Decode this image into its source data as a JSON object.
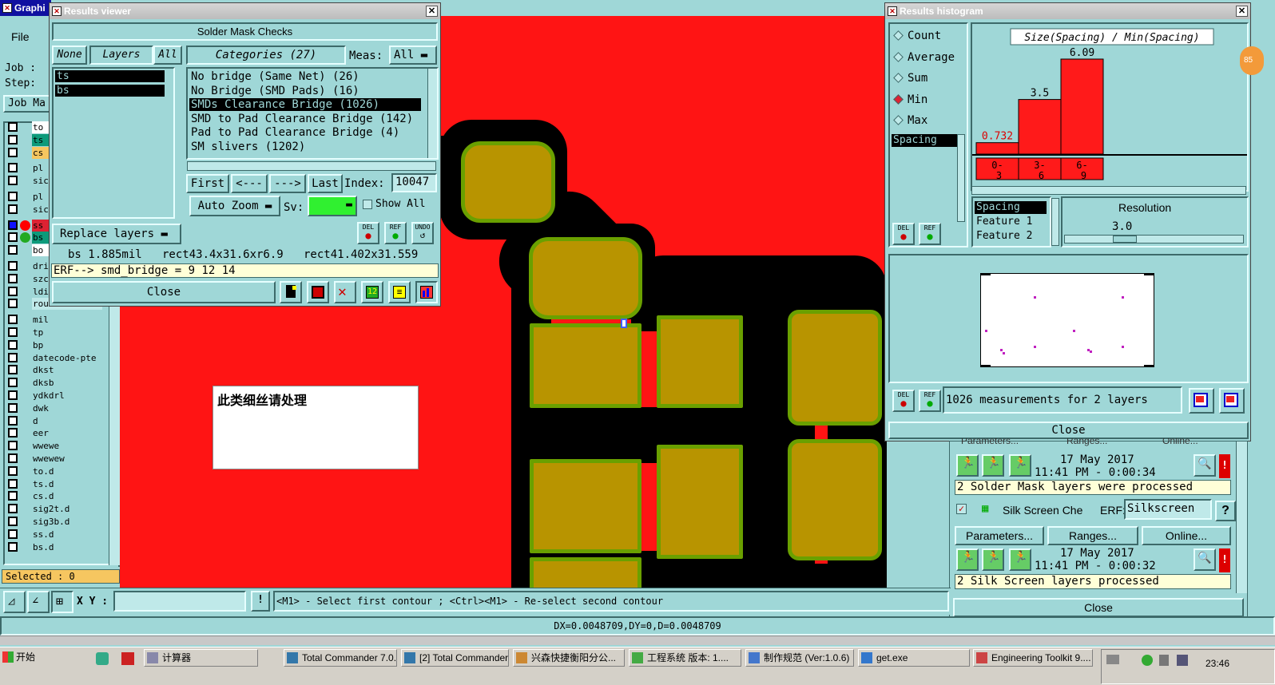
{
  "main_window": {
    "title": "Graphi",
    "menu_file": "File",
    "job_label": "Job :",
    "step_label": "Step:",
    "job_button": "Job Ma",
    "layers": [
      "to",
      "ts",
      "cs",
      "pl",
      "sic",
      "pl",
      "sic",
      "ss",
      "bs",
      "bo",
      "dri",
      "szc",
      "ldi",
      "rout",
      "mil",
      "tp",
      "bp",
      "datecode-pte",
      "dkst",
      "dksb",
      "ydkdrl",
      "dwk",
      "d",
      "eer",
      "wwewe",
      "wwewew",
      "to.d",
      "ts.d",
      "cs.d",
      "sig2t.d",
      "sig3b.d",
      "ss.d",
      "bs.d"
    ],
    "selected": "Selected : 0",
    "xy_label": "X Y :",
    "xy_value": "",
    "status_hint": "<M1> - Select first contour ; <Ctrl><M1> - Re-select second contour",
    "measure_readout": "DX=0.0048709,DY=0,D=0.0048709",
    "annotation_text": "此类细丝请处理"
  },
  "results_viewer": {
    "title": "Results viewer",
    "header": "Solder Mask Checks",
    "none_btn": "None",
    "layers_label": "Layers",
    "all_btn": "All",
    "layer_list": [
      "ts",
      "bs"
    ],
    "categories_label": "Categories (27)",
    "meas_label": "Meas:",
    "meas_value": "All",
    "categories": [
      "No bridge (Same Net) (26)",
      "No Bridge (SMD Pads) (16)",
      "SMDs Clearance Bridge (1026)",
      "SMD to Pad Clearance Bridge (142)",
      "Pad to Pad Clearance Bridge (4)",
      "SM slivers (1202)"
    ],
    "selected_category": 2,
    "first_btn": "First",
    "prev_btn": "<---",
    "next_btn": "--->",
    "last_btn": "Last",
    "index_label": "Index:",
    "index_value": "10047",
    "autozoom_btn": "Auto Zoom",
    "sv_label": "Sv:",
    "show_all_label": "Show All",
    "replace_layers_btn": "Replace layers",
    "del_label": "DEL",
    "ref_label": "REF",
    "undo_label": "UNDO",
    "info_line": "bs 1.885mil   rect43.4x31.6xr6.9   rect41.402x31.559",
    "erf_line": "ERF--> smd_bridge = 9 12 14",
    "close_btn": "Close"
  },
  "histogram": {
    "title": "Results histogram",
    "options": [
      "Count",
      "Average",
      "Sum",
      "Min",
      "Max"
    ],
    "selected_option": "Min",
    "left_list": [
      "Spacing"
    ],
    "chart_title": "Size(Spacing) / Min(Spacing)",
    "del_label": "DEL",
    "ref_label": "REF",
    "attr_list": [
      "Spacing",
      "Feature 1",
      "Feature 2"
    ],
    "resolution_label": "Resolution",
    "resolution_value": "3.0",
    "measurements_text": "1026 measurements for 2 layers",
    "close_btn": "Close",
    "badge": "85"
  },
  "chart_data": {
    "type": "bar",
    "title": "Size(Spacing) / Min(Spacing)",
    "categories": [
      "0-3",
      "3-6",
      "6-9"
    ],
    "values": [
      0.732,
      3.5,
      6.09
    ],
    "value_labels": [
      "0.732",
      "3.5",
      "6.09"
    ],
    "ylim": [
      0,
      6.09
    ]
  },
  "checklist": {
    "row1_date": "17 May 2017",
    "row1_time": "11:41 PM - 0:00:34",
    "row1_status": "2 Solder Mask layers were processed",
    "silk_title": "Silk Screen Che",
    "erf_label": "ERF:",
    "erf_value": "Silkscreen",
    "help": "?",
    "params_btn": "Parameters...",
    "ranges_btn": "Ranges...",
    "online_btn": "Online...",
    "row2_date": "17 May 2017",
    "row2_time": "11:41 PM - 0:00:32",
    "row2_status": "2 Silk Screen layers processed",
    "close_btn": "Close",
    "top_partial": [
      "Parameters...",
      "Ranges...",
      "Online..."
    ]
  },
  "taskbar": {
    "start": "开始",
    "items": [
      "计算器",
      "Total Commander 7.0...",
      "[2] Total Commander ...",
      "兴森快捷衡阳分公...",
      "工程系统  版本: 1....",
      "制作规范 (Ver:1.0.6)",
      "get.exe",
      "Engineering Toolkit 9...."
    ],
    "clock": "23:46"
  }
}
